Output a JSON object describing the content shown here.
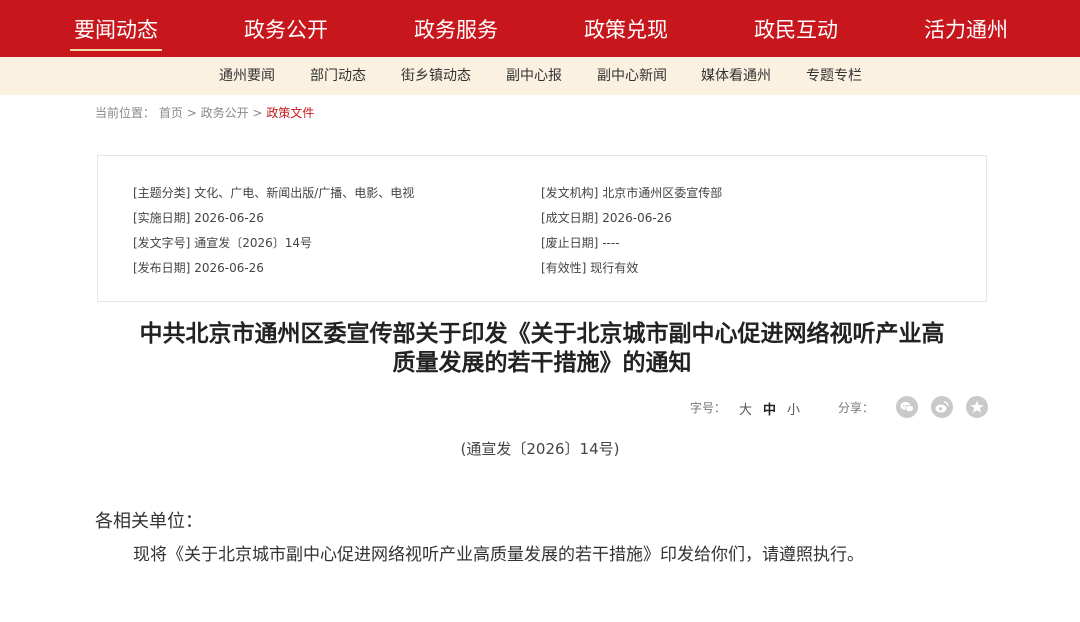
{
  "top_nav": [
    {
      "label": "要闻动态",
      "active": true
    },
    {
      "label": "政务公开"
    },
    {
      "label": "政务服务"
    },
    {
      "label": "政策兑现"
    },
    {
      "label": "政民互动"
    },
    {
      "label": "活力通州"
    }
  ],
  "sub_nav": [
    "通州要闻",
    "部门动态",
    "街乡镇动态",
    "副中心报",
    "副中心新闻",
    "媒体看通州",
    "专题专栏"
  ],
  "breadcrumb": {
    "prefix": "当前位置：",
    "home": "首页",
    "sep": ">",
    "section": "政务公开",
    "current": "政策文件"
  },
  "meta": {
    "topic_label": "[主题分类]",
    "topic_value": "文化、广电、新闻出版/广播、电影、电视",
    "issuer_label": "[发文机构]",
    "issuer_value": "北京市通州区委宣传部",
    "effective_label": "[实施日期]",
    "effective_value": "2026-06-26",
    "written_label": "[成文日期]",
    "written_value": "2026-06-26",
    "docno_label": "[发文字号]",
    "docno_value": "通宣发〔2026〕14号",
    "abolish_label": "[废止日期]",
    "abolish_value": "----",
    "publish_label": "[发布日期]",
    "publish_value": "2026-06-26",
    "validity_label": "[有效性]",
    "validity_value": "现行有效"
  },
  "article": {
    "title_line1": "中共北京市通州区委宣传部关于印发《关于北京城市副中心促进网络视听产业高",
    "title_line2": "质量发展的若干措施》的通知",
    "doc_number": "(通宣发〔2026〕14号)",
    "salutation": "各相关单位：",
    "body": "现将《关于北京城市副中心促进网络视听产业高质量发展的若干措施》印发给你们，请遵照执行。"
  },
  "tools": {
    "font_size_label": "字号：",
    "font_large": "大",
    "font_medium": "中",
    "font_small": "小",
    "share_label": "分享：",
    "share_icons": [
      "wechat-icon",
      "weibo-icon",
      "favorite-icon"
    ]
  },
  "colors": {
    "brand_red": "#c8161d",
    "subnav_bg": "#fbf1e1"
  }
}
